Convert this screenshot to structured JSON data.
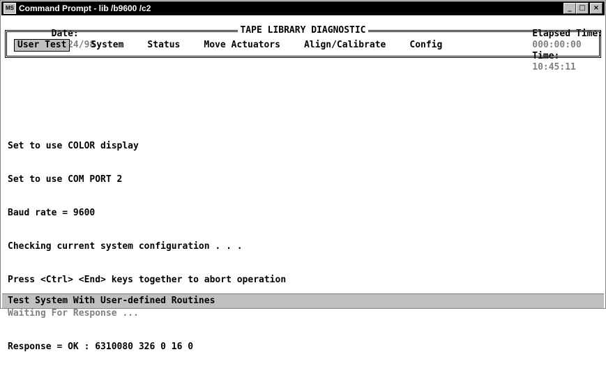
{
  "window": {
    "title": "Command Prompt - lib /b9600 /c2",
    "icon_text": "MS"
  },
  "status": {
    "date_label": "Date:",
    "date_value": "07/24/98",
    "elapsed_label": "Elapsed Time:",
    "elapsed_value": "000:00:00",
    "time_label": "Time:",
    "time_value": "10:45:11"
  },
  "menu": {
    "frame_title": "TAPE LIBRARY DIAGNOSTIC",
    "items": [
      {
        "label": "User Test",
        "selected": true
      },
      {
        "label": "System"
      },
      {
        "label": "Status"
      },
      {
        "label": "Move Actuators"
      },
      {
        "label": "Align/Calibrate"
      },
      {
        "label": "Config"
      }
    ]
  },
  "output": {
    "lines": [
      {
        "text": "Set to use COLOR display"
      },
      {
        "text": "Set to use COM PORT 2"
      },
      {
        "text": "Baud rate = 9600"
      },
      {
        "text": "Checking current system configuration . . ."
      },
      {
        "text": "Press <Ctrl> <End> keys together to abort operation"
      },
      {
        "text": "Waiting For Response ..."
      },
      {
        "text": "Response = OK : 6310080 326 0 16 0"
      }
    ]
  },
  "help_bar": {
    "text": "Test System With User-defined Routines"
  }
}
